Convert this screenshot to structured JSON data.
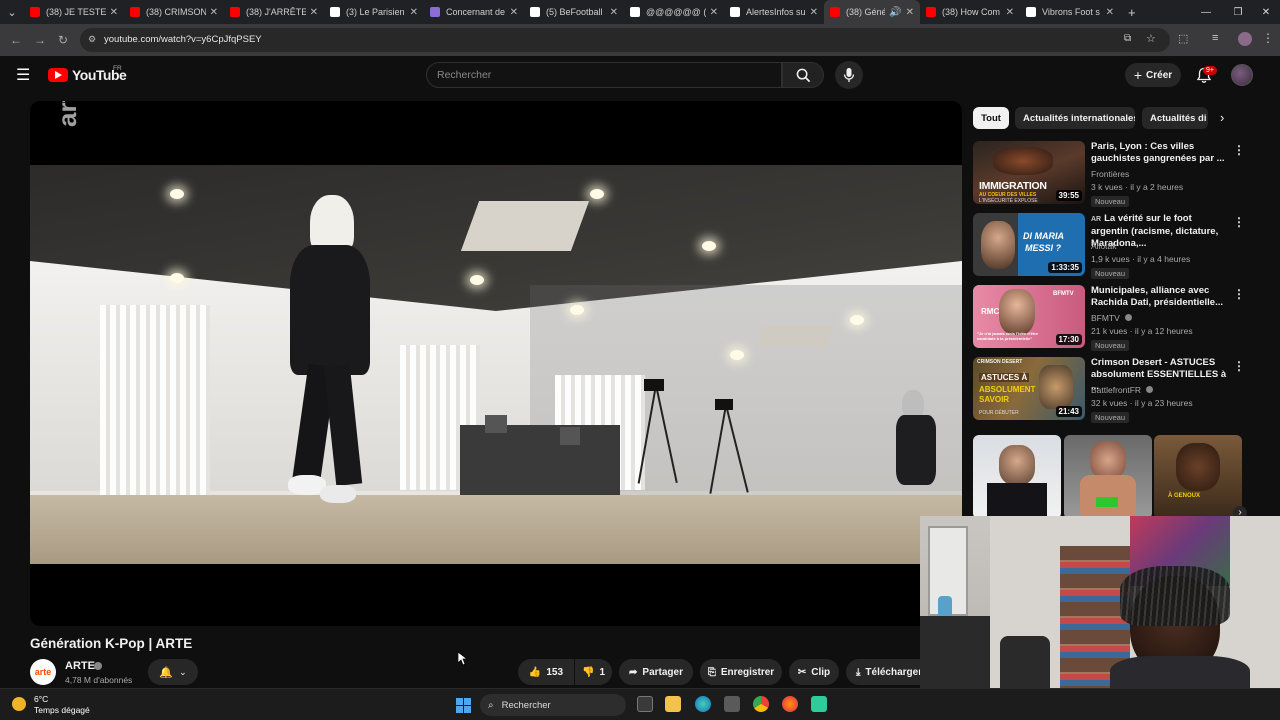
{
  "browser": {
    "tabs": [
      {
        "label": "(38) JE TESTE L",
        "favicon_color": "#ff0000"
      },
      {
        "label": "(38) CRIMSON",
        "favicon_color": "#ff0000"
      },
      {
        "label": "(38) J'ARRÊTE T",
        "favicon_color": "#ff0000"
      },
      {
        "label": "(3) Le Parisien",
        "favicon_color": "#ffffff"
      },
      {
        "label": "Concernant de",
        "favicon_color": "#8c6cd6"
      },
      {
        "label": "(5) BeFootball",
        "favicon_color": "#ffffff"
      },
      {
        "label": "@@@@@@ (@a",
        "favicon_color": "#ffffff"
      },
      {
        "label": "AlertesInfos su",
        "favicon_color": "#ffffff"
      },
      {
        "label": "(38) Géné",
        "favicon_color": "#ff0000",
        "active": true
      },
      {
        "label": "(38) How Com",
        "favicon_color": "#ff0000"
      },
      {
        "label": "Vibrons Foot s",
        "favicon_color": "#ffffff"
      }
    ],
    "close_glyph": "✕",
    "new_tab_glyph": "+",
    "url": "youtube.com/watch?v=y6CpJfqPSEY"
  },
  "youtube": {
    "logo_text": "YouTube",
    "region": "FR",
    "search_placeholder": "Rechercher",
    "create_label": "Créer",
    "notif_count": "9+"
  },
  "video": {
    "watermark": "arte",
    "title": "Génération K-Pop | ARTE",
    "channel": {
      "avatar_text": "arte",
      "name": "ARTE",
      "subscribers": "4,78 M d'abonnés"
    },
    "actions": {
      "likes": "153",
      "dislikes": "1",
      "share": "Partager",
      "save": "Enregistrer",
      "clip": "Clip",
      "download": "Télécharger"
    }
  },
  "sidebar": {
    "chips": [
      "Tout",
      "Actualités internationales",
      "Actualités di"
    ],
    "recommendations": [
      {
        "title": "Paris, Lyon : Ces villes gauchistes gangrenées par ...",
        "channel": "Frontières",
        "meta": "3 k vues · il y a 2 heures",
        "badge": "Nouveau",
        "duration": "39:55",
        "thumb_text": "IMMIGRATION",
        "thumb_subtext": "AU COEUR DES VILLES",
        "thumb_caption": "L'INSÉCURITÉ EXPLOSE"
      },
      {
        "title": "La vérité sur le foot argentin (racisme, dictature, Maradona,...",
        "channel": "Aliotak",
        "meta": "1,9 k vues · il y a 4 heures",
        "badge": "Nouveau",
        "duration": "1:33:35",
        "prefix": "AR",
        "thumb_text": "DI MARIA",
        "thumb_subtext": "MESSI ?"
      },
      {
        "title": "Municipales, alliance avec Rachida Dati, présidentielle...",
        "channel": "BFMTV",
        "meta": "21 k vues · il y a 12 heures",
        "badge": "Nouveau",
        "duration": "17:30",
        "thumb_text": "RMC",
        "thumb_subtext": "BFMTV",
        "thumb_caption": "\"Je n'ai jamais émis l'idée d'être candidate à la présidentielle\""
      },
      {
        "title": "Crimson Desert - ASTUCES absolument ESSENTIELLES à ...",
        "channel": "BattlefrontFR",
        "meta": "32 k vues · il y a 23 heures",
        "badge": "Nouveau",
        "duration": "21:43",
        "thumb_text": "ASTUCES À",
        "thumb_subtext": "ABSOLUMENT SAVOIR",
        "thumb_caption": "CRIMSON DESERT",
        "thumb_footer": "POUR DÉBUTER"
      }
    ],
    "shorts": [
      {
        "thumb_text": ""
      },
      {
        "thumb_text": ""
      },
      {
        "thumb_text": "À GENOUX"
      }
    ]
  },
  "taskbar": {
    "temperature": "6°C",
    "weather": "Temps dégagé",
    "search_label": "Rechercher"
  }
}
